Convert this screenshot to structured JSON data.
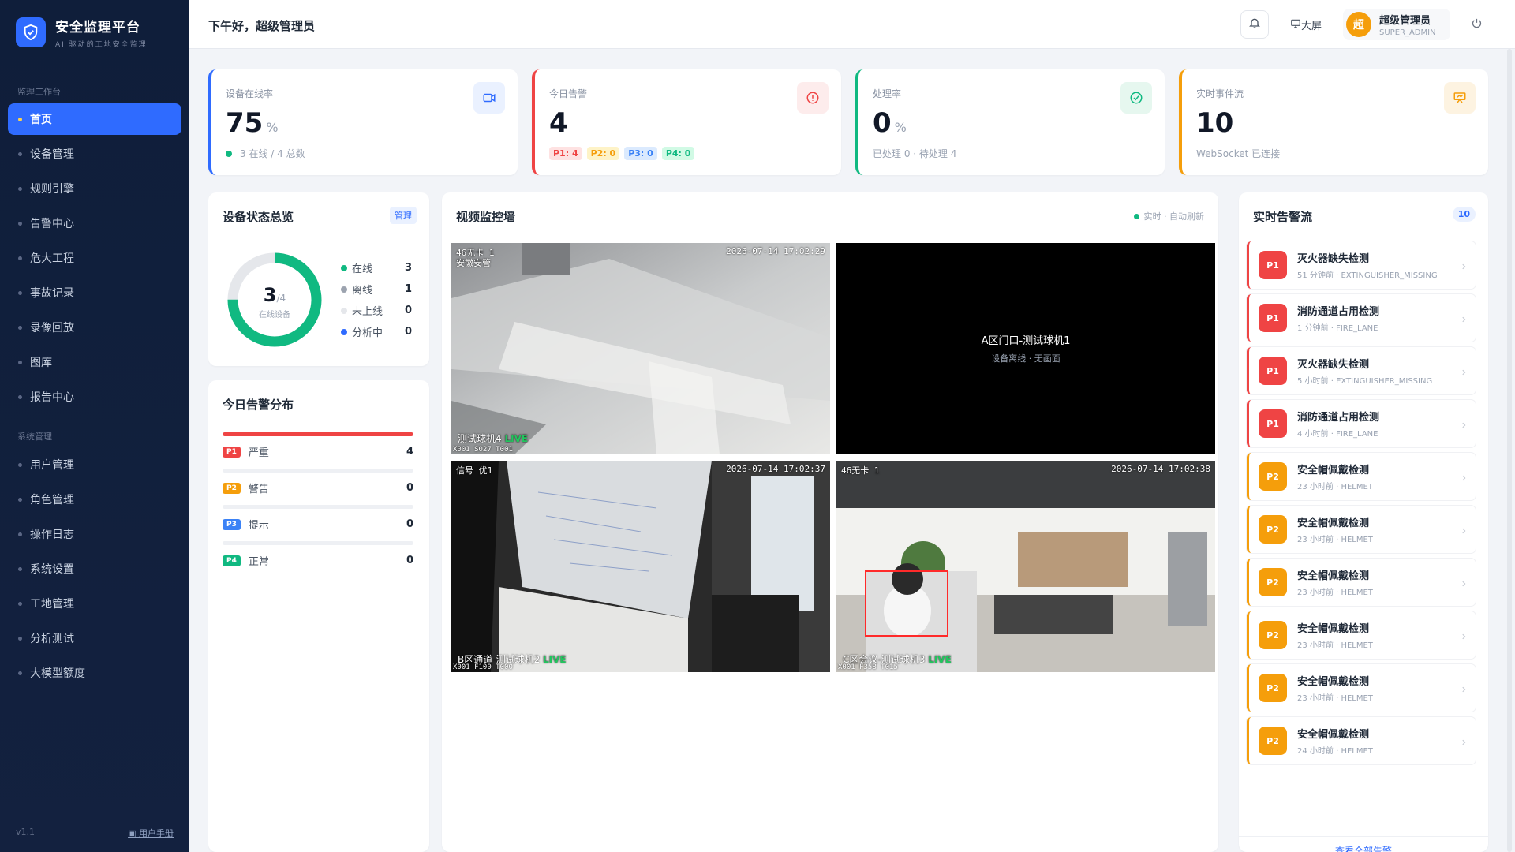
{
  "brand": {
    "title": "安全监理平台",
    "subtitle": "AI 驱动的工地安全监理"
  },
  "sidebar": {
    "section1": "监理工作台",
    "section2": "系统管理",
    "items": [
      "首页",
      "设备管理",
      "规则引擎",
      "告警中心",
      "危大工程",
      "事故记录",
      "录像回放",
      "图库",
      "报告中心"
    ],
    "items2": [
      "用户管理",
      "角色管理",
      "操作日志",
      "系统设置",
      "工地管理",
      "分析测试",
      "大模型额度"
    ],
    "version": "v1.1",
    "manual": "用户手册"
  },
  "header": {
    "greeting": "下午好，超级管理员",
    "bigscreen": "大屏",
    "avatar_char": "超",
    "user_name": "超级管理员",
    "user_role": "SUPER_ADMIN",
    "icons": {
      "bell": "bell-icon",
      "monitor": "monitor-icon",
      "power": "power-icon"
    }
  },
  "stats": {
    "online": {
      "label": "设备在线率",
      "value": "75",
      "unit": "%",
      "sub": "3 在线 / 4 总数",
      "color": "#2f6bff"
    },
    "alerts": {
      "label": "今日告警",
      "value": "4",
      "pills": [
        "P1: 4",
        "P2: 0",
        "P3: 0",
        "P4: 0"
      ],
      "color": "#ef4444"
    },
    "handle": {
      "label": "处理率",
      "value": "0",
      "unit": "%",
      "sub": "已处理 0 · 待处理 4",
      "color": "#10b981"
    },
    "events": {
      "label": "实时事件流",
      "value": "10",
      "sub": "WebSocket 已连接",
      "color": "#f59e0b"
    }
  },
  "device_panel": {
    "title": "设备状态总览",
    "manage": "管理",
    "donut_value": "3",
    "donut_total": "/4",
    "donut_label": "在线设备",
    "online_fraction": 0.75,
    "legend": [
      {
        "label": "在线",
        "value": "3",
        "color": "#10b981"
      },
      {
        "label": "离线",
        "value": "1",
        "color": "#9ca3af"
      },
      {
        "label": "未上线",
        "value": "0",
        "color": "#e5e7eb"
      },
      {
        "label": "分析中",
        "value": "0",
        "color": "#2f6bff"
      }
    ]
  },
  "dist_panel": {
    "title": "今日告警分布",
    "rows": [
      {
        "tag": "P1",
        "label": "严重",
        "count": "4",
        "fraction": 1.0,
        "color": "#ef4444"
      },
      {
        "tag": "P2",
        "label": "警告",
        "count": "0",
        "fraction": 0,
        "color": "#f59e0b"
      },
      {
        "tag": "P3",
        "label": "提示",
        "count": "0",
        "fraction": 0,
        "color": "#3b82f6"
      },
      {
        "tag": "P4",
        "label": "正常",
        "count": "0",
        "fraction": 0,
        "color": "#10b981"
      }
    ]
  },
  "video_panel": {
    "title": "视频监控墙",
    "status": "实时 · 自动刷新",
    "cam1": {
      "top_left": "46无卡 1",
      "top_left2": "安徽安管",
      "time": "2026-07-14 17:02:29",
      "name": "测试球机4",
      "live": "LIVE",
      "code": "X001 S027 T001"
    },
    "cam2": {
      "name": "A区门口-测试球机1",
      "status": "设备离线 · 无画面"
    },
    "cam3": {
      "top_left": "信号 优1",
      "time": "2026-07-14 17:02:37",
      "name": "B区通道-测试球机2",
      "live": "LIVE",
      "code": "X001 F100 T000"
    },
    "cam4": {
      "top_left": "46无卡 1",
      "time": "2026-07-14 17:02:38",
      "name": "C区会议-测试球机3",
      "live": "LIVE",
      "code": "X001 F358 T015"
    }
  },
  "alert_panel": {
    "title": "实时告警流",
    "count": "10",
    "view_all": "查看全部告警",
    "items": [
      {
        "level": "P1",
        "title": "灭火器缺失检测",
        "meta": "51 分钟前 · EXTINGUISHER_MISSING"
      },
      {
        "level": "P1",
        "title": "消防通道占用检测",
        "meta": "1 分钟前 · FIRE_LANE"
      },
      {
        "level": "P1",
        "title": "灭火器缺失检测",
        "meta": "5 小时前 · EXTINGUISHER_MISSING"
      },
      {
        "level": "P1",
        "title": "消防通道占用检测",
        "meta": "4 小时前 · FIRE_LANE"
      },
      {
        "level": "P2",
        "title": "安全帽佩戴检测",
        "meta": "23 小时前 · HELMET"
      },
      {
        "level": "P2",
        "title": "安全帽佩戴检测",
        "meta": "23 小时前 · HELMET"
      },
      {
        "level": "P2",
        "title": "安全帽佩戴检测",
        "meta": "23 小时前 · HELMET"
      },
      {
        "level": "P2",
        "title": "安全帽佩戴检测",
        "meta": "23 小时前 · HELMET"
      },
      {
        "level": "P2",
        "title": "安全帽佩戴检测",
        "meta": "23 小时前 · HELMET"
      },
      {
        "level": "P2",
        "title": "安全帽佩戴检测",
        "meta": "24 小时前 · HELMET"
      }
    ],
    "colors": {
      "P1": "#ef4444",
      "P2": "#f59e0b"
    }
  }
}
